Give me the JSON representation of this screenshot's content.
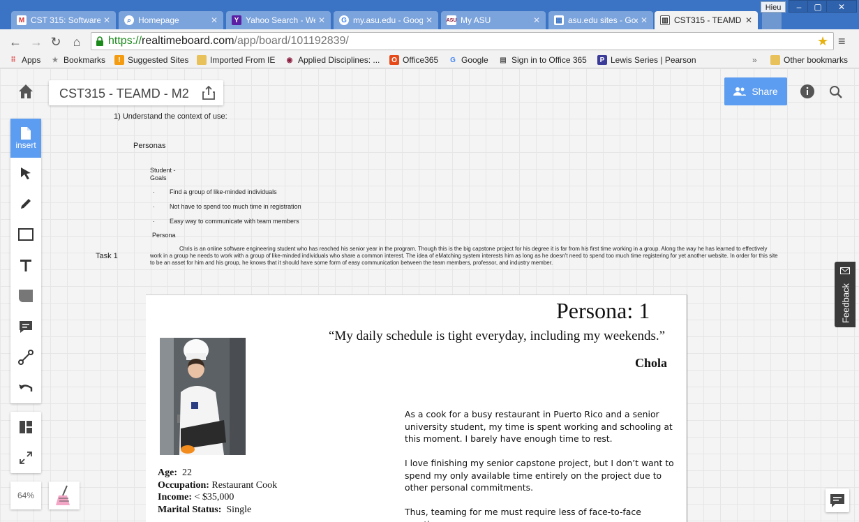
{
  "browser": {
    "user": "Hieu",
    "tabs": [
      {
        "label": "CST 315: Software",
        "icon": "gmail-icon"
      },
      {
        "label": "Homepage",
        "icon": "search-icon"
      },
      {
        "label": "Yahoo Search - We",
        "icon": "yahoo-icon"
      },
      {
        "label": "my.asu.edu - Goog",
        "icon": "google-icon"
      },
      {
        "label": "My ASU",
        "icon": "asu-icon"
      },
      {
        "label": "asu.edu sites - Goo",
        "icon": "sites-icon"
      },
      {
        "label": "CST315 - TEAMD -",
        "icon": "board-icon"
      }
    ],
    "url": {
      "scheme": "https://",
      "host": "realtimeboard.com",
      "path": "/app/board/101192839/"
    },
    "bookmarks": [
      {
        "label": "Apps"
      },
      {
        "label": "Bookmarks"
      },
      {
        "label": "Suggested Sites"
      },
      {
        "label": "Imported From IE"
      },
      {
        "label": "Applied Disciplines: ..."
      },
      {
        "label": "Office365"
      },
      {
        "label": "Google"
      },
      {
        "label": "Sign in to Office 365"
      },
      {
        "label": "Lewis Series | Pearson"
      },
      {
        "label": "»"
      },
      {
        "label": "Other bookmarks"
      }
    ]
  },
  "app": {
    "board_name": "CST315 - TEAMD - M2",
    "share_label": "Share",
    "insert_label": "insert",
    "zoom": "64%",
    "feedback_label": "Feedback"
  },
  "board": {
    "heading": "1) Understand the context of use:",
    "personas_label": "Personas",
    "student_label": "Student -",
    "goals_label": "Goals",
    "goals": [
      "Find a group of like-minded individuals",
      "Not have to spend too much time in registration",
      "Easy way to communicate with team members"
    ],
    "bullet": "·",
    "persona_label": "Persona",
    "task_label": "Task 1",
    "persona_paragraph": "Chris is an online software engineering student who has reached his senior year in the program. Though this is the big capstone project for his degree it is far from his first time working in a group. Along the way he has learned to effectively work in a group he needs to work with a group of like-minded individuals who share a common interest. The idea of eMatching system interests him as long as he doesn't need to spend too much time registering for yet another website. In order for this site to be an asset for him and his group, he knows that it should have some form of easy communication between the team members, professor, and industry member."
  },
  "persona_doc": {
    "title": "Persona: 1",
    "quote": "“My daily schedule is tight everyday, including my weekends.”",
    "name": "Chola",
    "facts": [
      {
        "key": "Age:",
        "value": "22"
      },
      {
        "key": "Occupation:",
        "value": "Restaurant Cook"
      },
      {
        "key": "Income:",
        "value": "< $35,000"
      },
      {
        "key": "Marital Status:",
        "value": "Single"
      }
    ],
    "paragraphs": [
      "As a cook for a busy restaurant in Puerto Rico and a senior university student, my time is spent working and schooling at this moment. I barely have enough time to rest.",
      "I love finishing my senior capstone project, but I don’t want to spend my only available time entirely on the project due to other personal commitments.",
      "Thus, teaming for me must require less of face-to-face meetings"
    ]
  },
  "colors": {
    "titlebar": "#3b74c4",
    "accent": "#5c9cf1",
    "secure": "#1a8a1a"
  }
}
